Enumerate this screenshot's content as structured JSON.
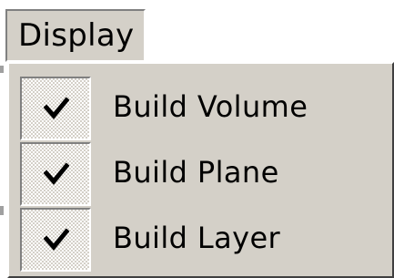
{
  "menubar": {
    "display_label": "Display"
  },
  "menu": {
    "items": [
      {
        "label": "Build Volume",
        "checked": true,
        "check_icon": "checkmark-icon"
      },
      {
        "label": "Build Plane",
        "checked": true,
        "check_icon": "checkmark-icon"
      },
      {
        "label": "Build Layer",
        "checked": true,
        "check_icon": "checkmark-icon"
      }
    ]
  },
  "colors": {
    "menu_face": "#d4d0c8",
    "highlight": "#ffffff",
    "shadow": "#808080",
    "dark_shadow": "#404040",
    "text": "#000000"
  }
}
